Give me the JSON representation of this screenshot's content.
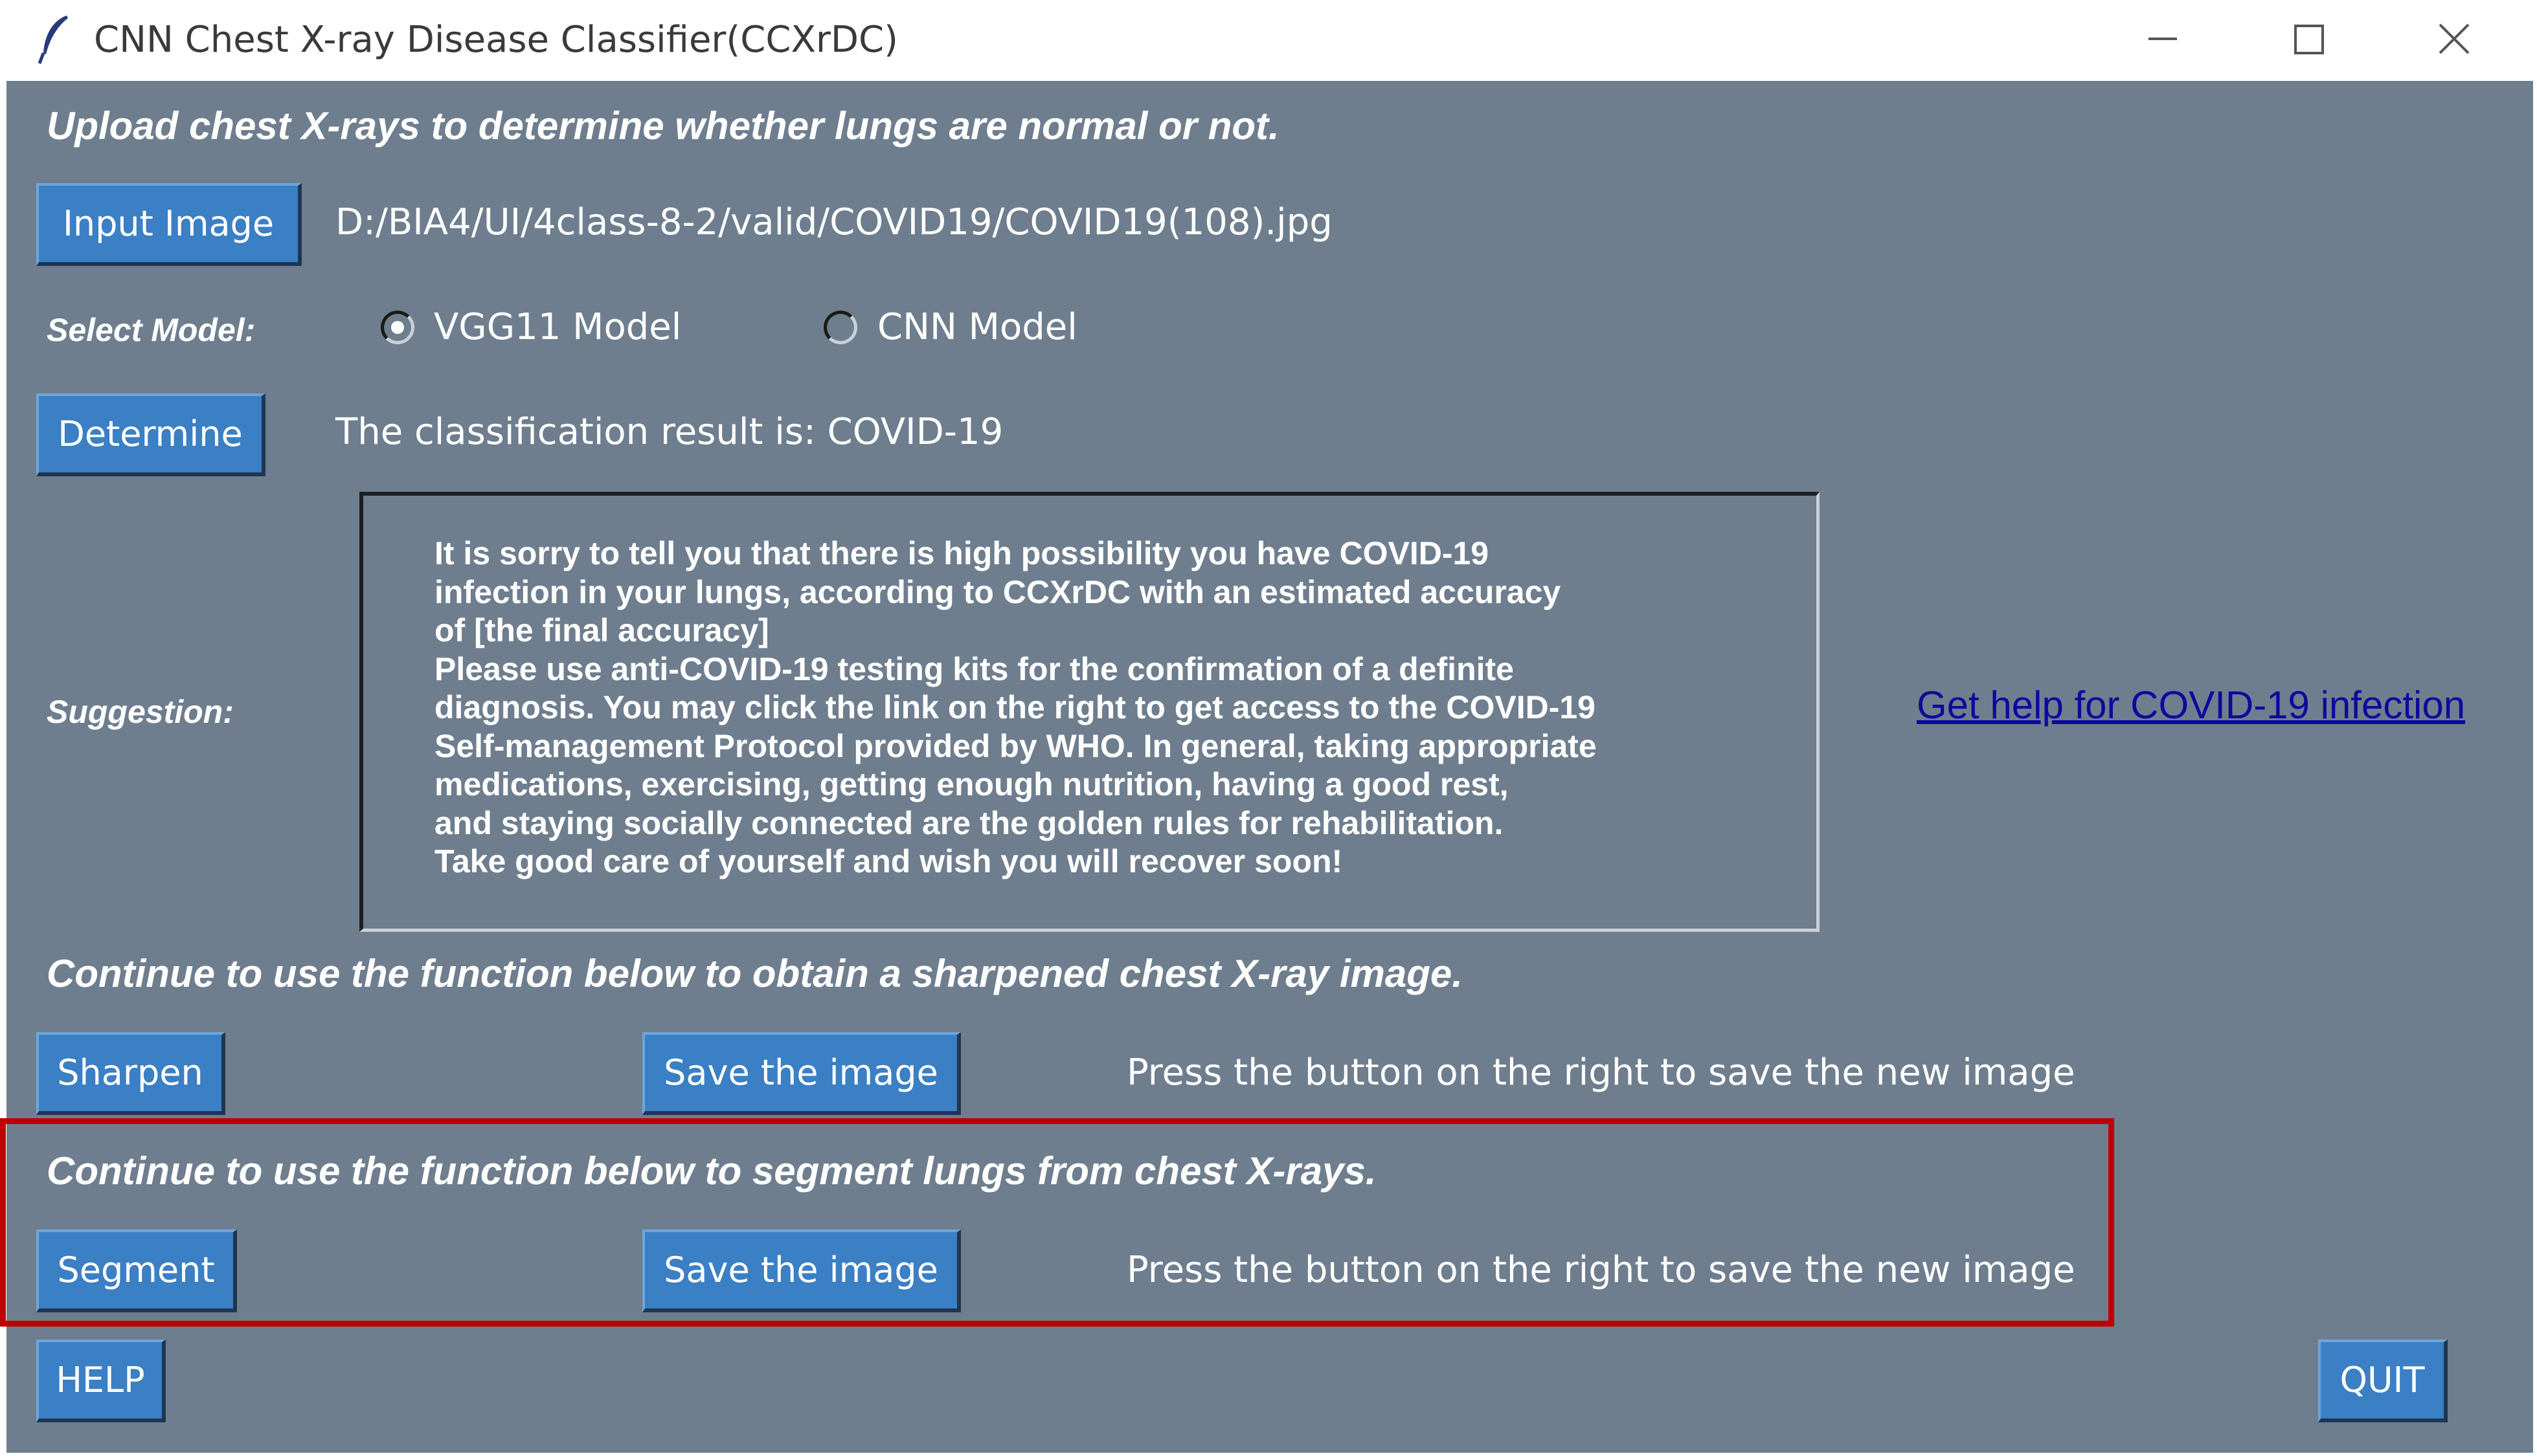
{
  "window": {
    "title": "CNN Chest X-ray Disease Classifier(CCXrDC)",
    "icons": {
      "app": "feather-icon",
      "minimize": "minimize-icon",
      "maximize": "maximize-icon",
      "close": "close-icon"
    }
  },
  "upload": {
    "heading": "Upload chest X-rays to determine whether lungs are normal or not.",
    "input_button": "Input Image",
    "file_path": "D:/BIA4/UI/4class-8-2/valid/COVID19/COVID19(108).jpg"
  },
  "model": {
    "label": "Select Model:",
    "options": [
      {
        "label": "VGG11 Model",
        "selected": true
      },
      {
        "label": "CNN Model",
        "selected": false
      }
    ]
  },
  "determine": {
    "button": "Determine",
    "result": "The classification result is: COVID-19"
  },
  "suggestion": {
    "label": "Suggestion:",
    "text": "It is sorry to tell you that there is high possibility you have COVID-19\ninfection in your lungs, according to CCXrDC with an estimated accuracy\nof [the final accuracy]\nPlease use anti-COVID-19 testing kits for the confirmation of a definite\ndiagnosis. You may click the link on the right to get access to the COVID-19\nSelf-management Protocol provided by WHO. In general, taking appropriate\nmedications, exercising, getting enough nutrition, having a good rest,\nand staying socially connected are the golden rules for rehabilitation.\nTake good care of yourself and wish you will recover soon!",
    "link": "Get help for COVID-19 infection"
  },
  "sharpen": {
    "heading": "Continue to use the function below to obtain a sharpened chest X-ray image.",
    "button": "Sharpen",
    "save_button": "Save the image",
    "hint": "Press the button on the right to save the new image"
  },
  "segment": {
    "heading": "Continue to use the function below to segment lungs from chest X-rays.",
    "button": "Segment",
    "save_button": "Save the image",
    "hint": "Press the button on the right to save the new image"
  },
  "footer": {
    "help_button": "HELP",
    "quit_button": "QUIT"
  },
  "colors": {
    "background": "#6e7e8e",
    "button": "#3b7fc4",
    "link": "#0a0a9e",
    "highlight": "#c00000"
  }
}
